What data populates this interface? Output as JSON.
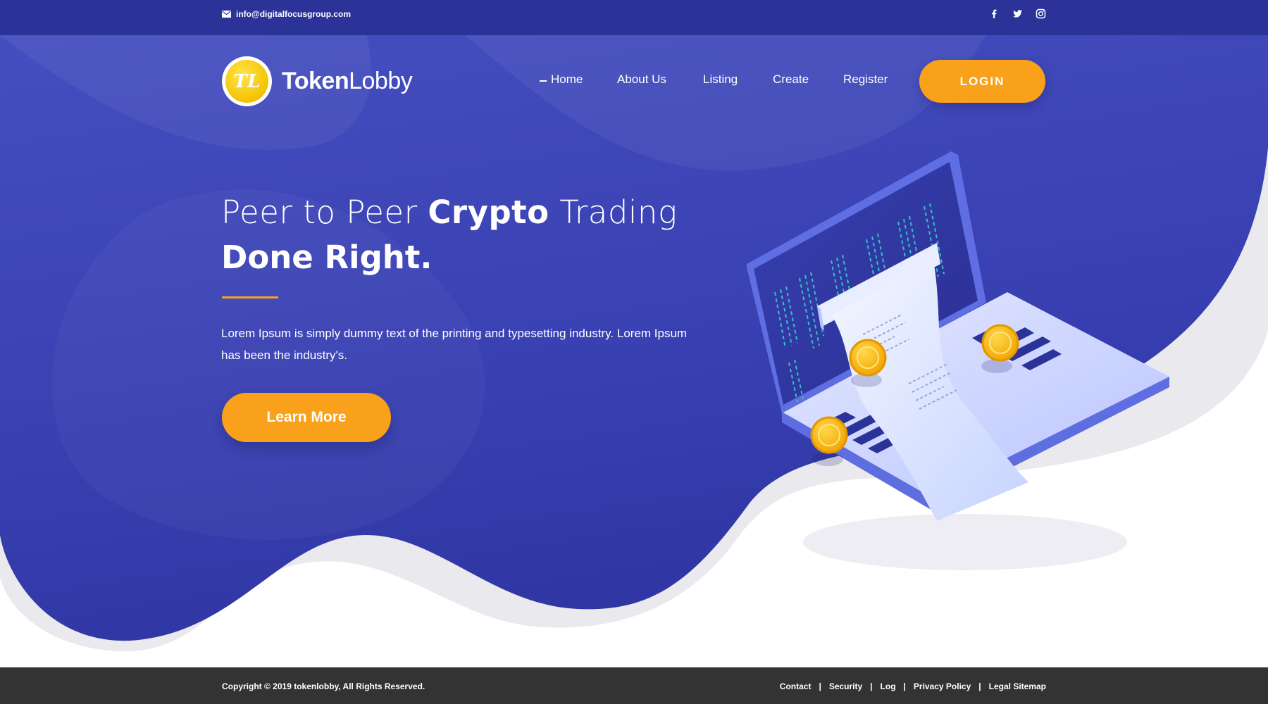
{
  "topbar": {
    "email": "info@digitalfocusgroup.com",
    "social": [
      "facebook-icon",
      "twitter-icon",
      "instagram-icon"
    ]
  },
  "header": {
    "logo_mark": "TL",
    "logo_bold": "Token",
    "logo_light": "Lobby",
    "nav": [
      "Home",
      "About Us",
      "Listing",
      "Create",
      "Register"
    ],
    "active_nav": "Home",
    "login_label": "LOGIN"
  },
  "hero": {
    "headline_pre": "Peer to Peer ",
    "headline_bold": "Crypto",
    "headline_post": " Trading",
    "headline_line2": "Done Right.",
    "description": "Lorem Ipsum is simply dummy text of the printing and typesetting industry. Lorem Ipsum has been the industry's.",
    "cta_label": "Learn More"
  },
  "footer": {
    "copyright": "Copyright © 2019 tokenlobby, All Rights Reserved.",
    "links": [
      "Contact",
      "Security",
      "Log",
      "Privacy Policy",
      "Legal Sitemap"
    ]
  },
  "colors": {
    "primary": "#2b3399",
    "hero": "#3a41b3",
    "accent": "#f9a11b",
    "footer": "#333333"
  }
}
